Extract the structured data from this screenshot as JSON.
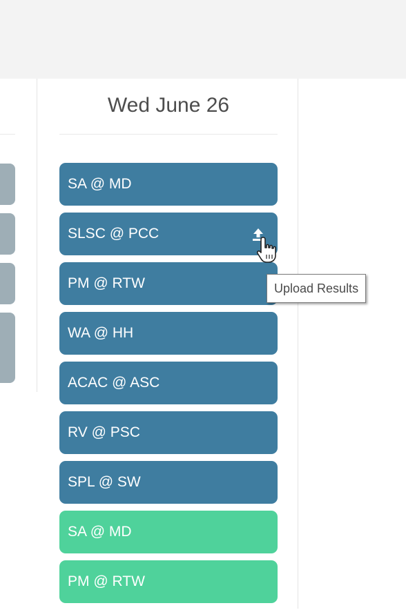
{
  "day": {
    "title": "Wed June 26"
  },
  "games": [
    {
      "label": "SA @ MD",
      "status": "scheduled"
    },
    {
      "label": "SLSC @ PCC",
      "status": "scheduled",
      "upload_icon": "upload-icon"
    },
    {
      "label": "PM @ RTW",
      "status": "scheduled"
    },
    {
      "label": "WA @ HH",
      "status": "scheduled"
    },
    {
      "label": "ACAC @ ASC",
      "status": "scheduled"
    },
    {
      "label": "RV @ PSC",
      "status": "scheduled"
    },
    {
      "label": "SPL @ SW",
      "status": "scheduled"
    },
    {
      "label": "SA @ MD",
      "status": "final"
    },
    {
      "label": "PM @ RTW",
      "status": "final"
    }
  ],
  "tooltip": {
    "text": "Upload Results"
  },
  "colors": {
    "scheduled": "#3f7da0",
    "final": "#4fd29b",
    "ghost": "#9eaeb6",
    "topbar": "#f3f3f3"
  }
}
